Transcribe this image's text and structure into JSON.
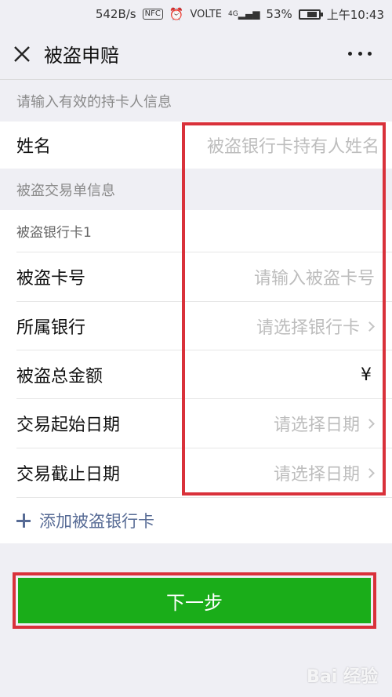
{
  "status_bar": {
    "speed": "542B/s",
    "nfc": "NFC",
    "volte": "VOLTE",
    "network": "4G",
    "battery": "53%",
    "time": "上午10:43"
  },
  "nav": {
    "title": "被盗申赔",
    "close_icon": "close-icon",
    "more_icon": "more-icon"
  },
  "section1": {
    "header": "请输入有效的持卡人信息"
  },
  "name_row": {
    "label": "姓名",
    "placeholder": "被盗银行卡持有人姓名"
  },
  "section2": {
    "header": "被盗交易单信息"
  },
  "card": {
    "subtitle": "被盗银行卡1",
    "rows": [
      {
        "label": "被盗卡号",
        "value": "请输入被盗卡号",
        "chevron": false
      },
      {
        "label": "所属银行",
        "value": "请选择银行卡",
        "chevron": true
      },
      {
        "label": "被盗总金额",
        "value": "¥",
        "chevron": false
      },
      {
        "label": "交易起始日期",
        "value": "请选择日期",
        "chevron": true
      },
      {
        "label": "交易截止日期",
        "value": "请选择日期",
        "chevron": true
      }
    ]
  },
  "add_card": {
    "label": "添加被盗银行卡"
  },
  "next_button": {
    "label": "下一步"
  },
  "watermark": "Bai 经验",
  "colors": {
    "accent_green": "#1aad19",
    "link_blue": "#576b95",
    "highlight_red": "#d9313a"
  }
}
